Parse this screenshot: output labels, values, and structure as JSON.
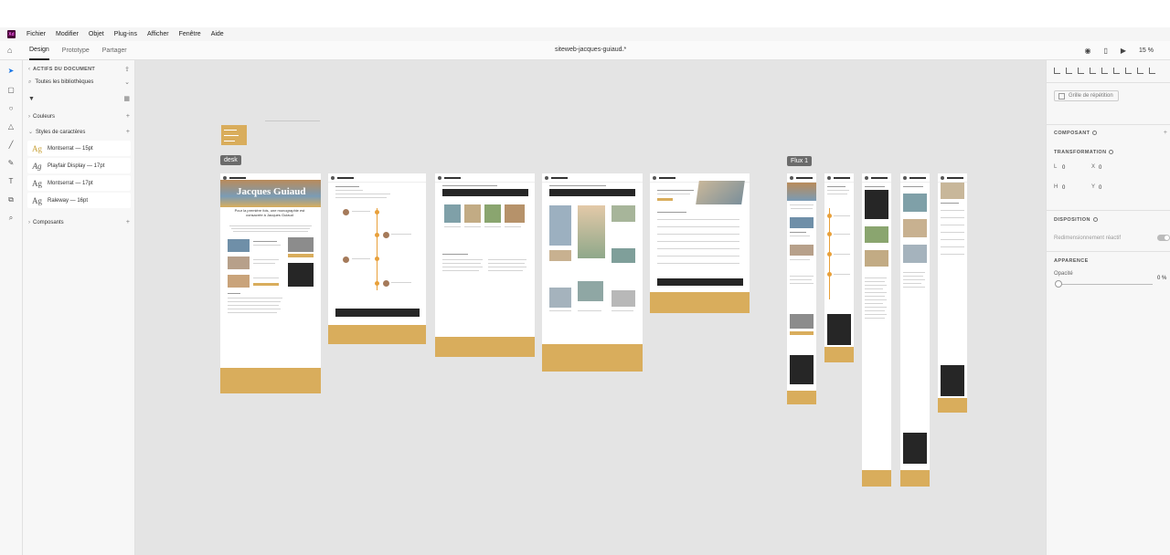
{
  "menubar": {
    "app_icon": "Xd",
    "items": [
      "Fichier",
      "Modifier",
      "Objet",
      "Plug-ins",
      "Afficher",
      "Fenêtre",
      "Aide"
    ]
  },
  "toolbar": {
    "tabs": [
      "Design",
      "Prototype",
      "Partager"
    ],
    "active_tab": "Design",
    "document_title": "siteweb-jacques-guiaud *",
    "zoom": "15 %",
    "icons": [
      "home-icon",
      "chevron-down-icon",
      "user-icon",
      "mobile-preview-icon",
      "play-icon"
    ]
  },
  "left_rail": {
    "tools": [
      "select-icon",
      "rectangle-icon",
      "ellipse-icon",
      "triangle-icon",
      "line-icon",
      "pen-icon",
      "text-icon",
      "artboard-icon",
      "zoom-icon"
    ]
  },
  "assets_panel": {
    "title": "ACTIFS DU DOCUMENT",
    "library_filter": "Toutes les bibliothèques",
    "sections": {
      "colors": "Couleurs",
      "char_styles": "Styles de caractères",
      "components": "Composants"
    },
    "char_styles": [
      {
        "sample": "Ag",
        "label": "Montserrat — 15pt"
      },
      {
        "sample": "Ag",
        "label": "Playfair Display — 17pt"
      },
      {
        "sample": "Ag",
        "label": "Montserrat — 17pt"
      },
      {
        "sample": "Ag",
        "label": "Raleway — 16pt"
      }
    ]
  },
  "canvas": {
    "labels": {
      "desk": "desk",
      "flux": "Flux 1"
    },
    "hero_title": "Jacques Guiaud",
    "hero_subtitle": "Pour la première fois, une monographie est consacrée à Jacques Guiaud",
    "accent_color": "#d9ad5c",
    "dark_color": "#262626"
  },
  "properties_panel": {
    "repeat_grid": "Grille de répétition",
    "component_label": "COMPOSANT",
    "transform_label": "TRANSFORMATION",
    "fields": {
      "l": "L",
      "x": "X",
      "h": "H",
      "y": "Y",
      "l_val": "0",
      "x_val": "0",
      "h_val": "0",
      "y_val": "0"
    },
    "layout_label": "DISPOSITION",
    "responsive_resize": "Redimensionnement réactif",
    "appearance_label": "APPARENCE",
    "opacity_label": "Opacité",
    "opacity_value": "0 %"
  }
}
